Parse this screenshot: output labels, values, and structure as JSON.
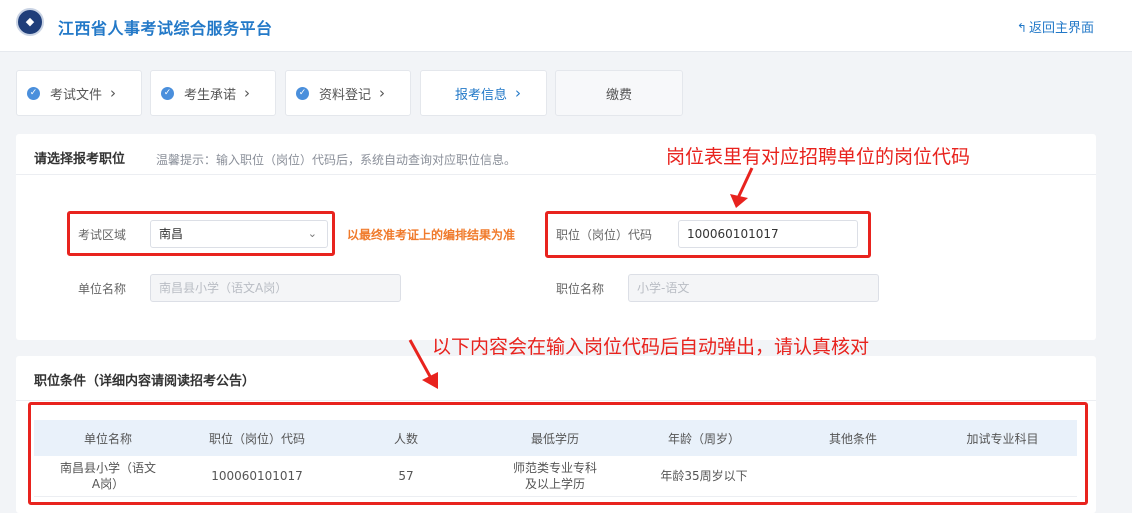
{
  "header": {
    "title": "江西省人事考试综合服务平台",
    "back_label": "返回主界面"
  },
  "steps": [
    {
      "label": "考试文件",
      "done": true
    },
    {
      "label": "考生承诺",
      "done": true
    },
    {
      "label": "资料登记",
      "done": true
    },
    {
      "label": "报考信息",
      "active": true
    },
    {
      "label": "缴费"
    }
  ],
  "select_section": {
    "title": "请选择报考职位",
    "hint": "温馨提示：输入职位（岗位）代码后，系统自动查询对应职位信息。",
    "exam_area_label": "考试区域",
    "exam_area_value": "南昌",
    "exam_area_note": "以最终准考证上的编排结果为准",
    "position_code_label": "职位（岗位）代码",
    "position_code_value": "100060101017",
    "unit_name_label": "单位名称",
    "unit_name_value": "南昌县小学（语文A岗）",
    "position_name_label": "职位名称",
    "position_name_value": "小学-语文"
  },
  "conditions_section": {
    "title": "职位条件（详细内容请阅读招考公告）",
    "columns": [
      "单位名称",
      "职位（岗位）代码",
      "人数",
      "最低学历",
      "年龄（周岁）",
      "其他条件",
      "加试专业科目"
    ],
    "rows": [
      [
        "南昌县小学（语文A岗）",
        "100060101017",
        "57",
        "师范类专业专科及以上学历",
        "年龄35周岁以下",
        "",
        ""
      ]
    ]
  },
  "annotations": {
    "top": "岗位表里有对应招聘单位的岗位代码",
    "middle": "以下内容会在输入岗位代码后自动弹出，请认真核对"
  },
  "colors": {
    "brand_blue": "#2379c8",
    "annotation_red": "#e8231e",
    "note_orange": "#f07a2b"
  }
}
